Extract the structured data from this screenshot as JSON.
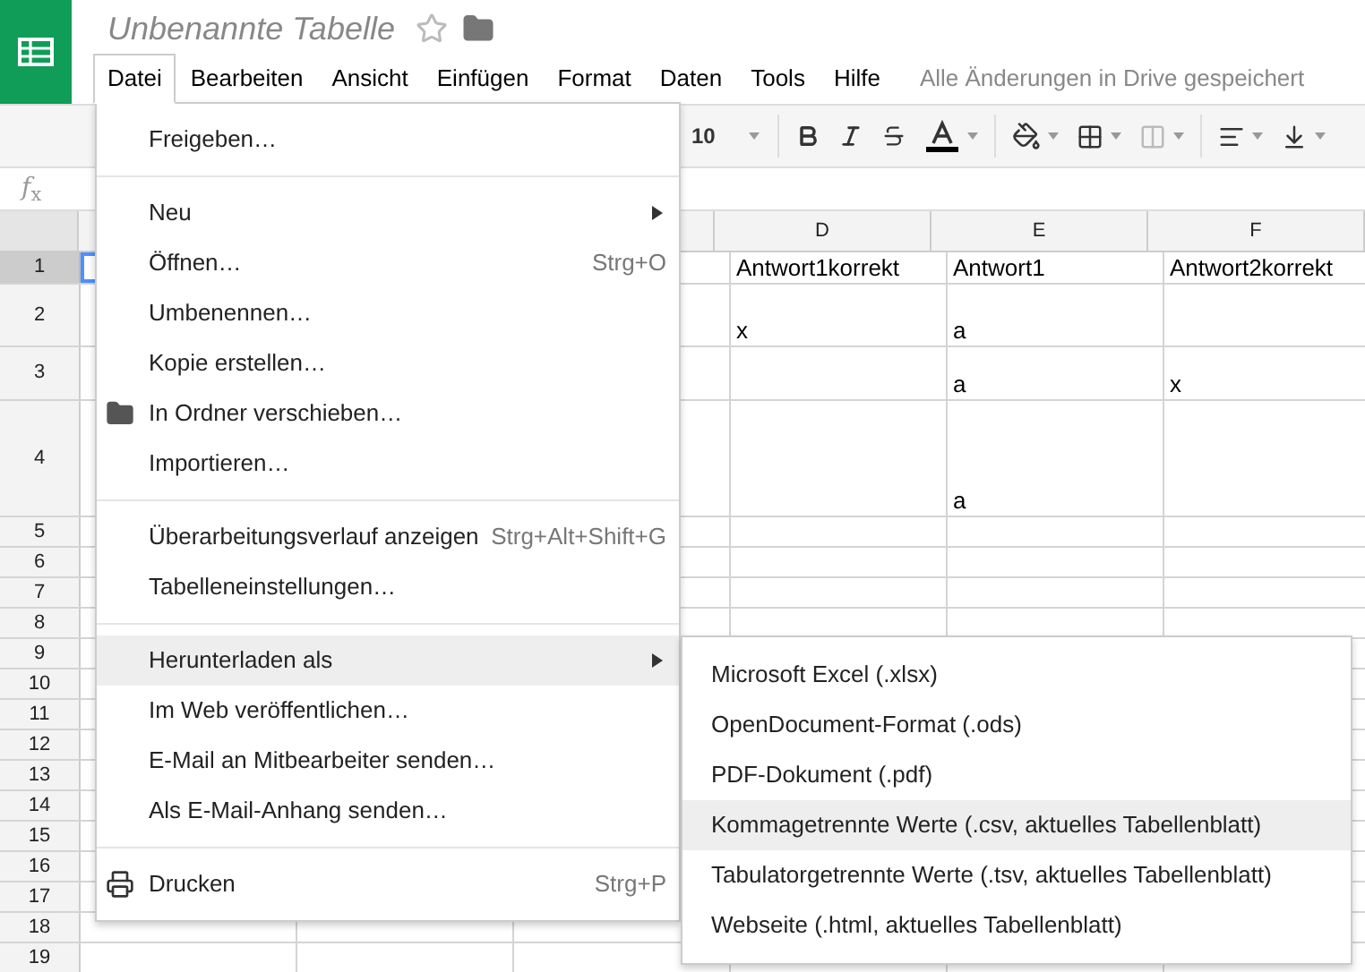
{
  "app": {
    "title": "Unbenannte Tabelle",
    "starred": false
  },
  "menubar": [
    {
      "label": "Datei",
      "selected": true
    },
    {
      "label": "Bearbeiten",
      "selected": false
    },
    {
      "label": "Ansicht",
      "selected": false
    },
    {
      "label": "Einfügen",
      "selected": false
    },
    {
      "label": "Format",
      "selected": false
    },
    {
      "label": "Daten",
      "selected": false
    },
    {
      "label": "Tools",
      "selected": false
    },
    {
      "label": "Hilfe",
      "selected": false
    }
  ],
  "save_status": "Alle Änderungen in Drive gespeichert",
  "toolbar": {
    "font_size": "10"
  },
  "formula_bar": {
    "label": "*f*$_{x}$"
  },
  "columns": [
    "D",
    "E",
    "F"
  ],
  "rows": [
    {
      "number": "1",
      "selected": true,
      "cells": [
        "Antwort1korrekt",
        "Antwort1",
        "Antwort2korrekt"
      ]
    },
    {
      "number": "2",
      "selected": false,
      "cells": [
        "x",
        "a",
        ""
      ]
    },
    {
      "number": "3",
      "selected": false,
      "cells": [
        "",
        "a",
        "x"
      ]
    },
    {
      "number": "4",
      "selected": false,
      "cells": [
        "",
        "a",
        ""
      ]
    },
    {
      "number": "5",
      "selected": false,
      "cells": []
    },
    {
      "number": "6",
      "selected": false,
      "cells": []
    },
    {
      "number": "7",
      "selected": false,
      "cells": []
    },
    {
      "number": "8",
      "selected": false,
      "cells": []
    },
    {
      "number": "9",
      "selected": false,
      "cells": []
    },
    {
      "number": "10",
      "selected": false,
      "cells": []
    },
    {
      "number": "11",
      "selected": false,
      "cells": []
    },
    {
      "number": "12",
      "selected": false,
      "cells": []
    },
    {
      "number": "13",
      "selected": false,
      "cells": []
    },
    {
      "number": "14",
      "selected": false,
      "cells": []
    },
    {
      "number": "15",
      "selected": false,
      "cells": []
    },
    {
      "number": "16",
      "selected": false,
      "cells": []
    },
    {
      "number": "17",
      "selected": false,
      "cells": []
    },
    {
      "number": "18",
      "selected": false,
      "cells": []
    },
    {
      "number": "19",
      "selected": false,
      "cells": []
    }
  ],
  "file_menu": {
    "groups": [
      [
        {
          "label": "Freigeben…",
          "kind": "plain",
          "selected": false
        }
      ],
      [
        {
          "label": "Neu",
          "kind": "submenu",
          "selected": false
        },
        {
          "label": "Öffnen…",
          "kind": "plain",
          "shortcut": "Strg+O",
          "selected": false
        },
        {
          "label": "Umbenennen…",
          "kind": "plain",
          "selected": false
        },
        {
          "label": "Kopie erstellen…",
          "kind": "plain",
          "selected": false
        },
        {
          "label": "In Ordner verschieben…",
          "kind": "folder",
          "selected": false
        },
        {
          "label": "Importieren…",
          "kind": "plain",
          "selected": false
        }
      ],
      [
        {
          "label": "Überarbeitungsverlauf anzeigen",
          "kind": "plain",
          "shortcut": "Strg+Alt+Shift+G",
          "selected": false
        },
        {
          "label": "Tabelleneinstellungen…",
          "kind": "plain",
          "selected": false
        }
      ],
      [
        {
          "label": "Herunterladen als",
          "kind": "submenu",
          "selected": true
        },
        {
          "label": "Im Web veröffentlichen…",
          "kind": "plain",
          "selected": false
        },
        {
          "label": "E-Mail an Mitbearbeiter senden…",
          "kind": "plain",
          "selected": false
        },
        {
          "label": "Als E-Mail-Anhang senden…",
          "kind": "plain",
          "selected": false
        }
      ],
      [
        {
          "label": "Drucken",
          "kind": "print",
          "shortcut": "Strg+P",
          "selected": false
        }
      ]
    ]
  },
  "download_menu": [
    {
      "label": "Microsoft Excel (.xlsx)",
      "selected": false
    },
    {
      "label": "OpenDocument-Format (.ods)",
      "selected": false
    },
    {
      "label": "PDF-Dokument (.pdf)",
      "selected": false
    },
    {
      "label": "Kommagetrennte Werte (.csv, aktuelles Tabellenblatt)",
      "selected": true
    },
    {
      "label": "Tabulatorgetrennte Werte (.tsv, aktuelles Tabellenblatt)",
      "selected": false
    },
    {
      "label": "Webseite (.html, aktuelles Tabellenblatt)",
      "selected": false
    }
  ]
}
